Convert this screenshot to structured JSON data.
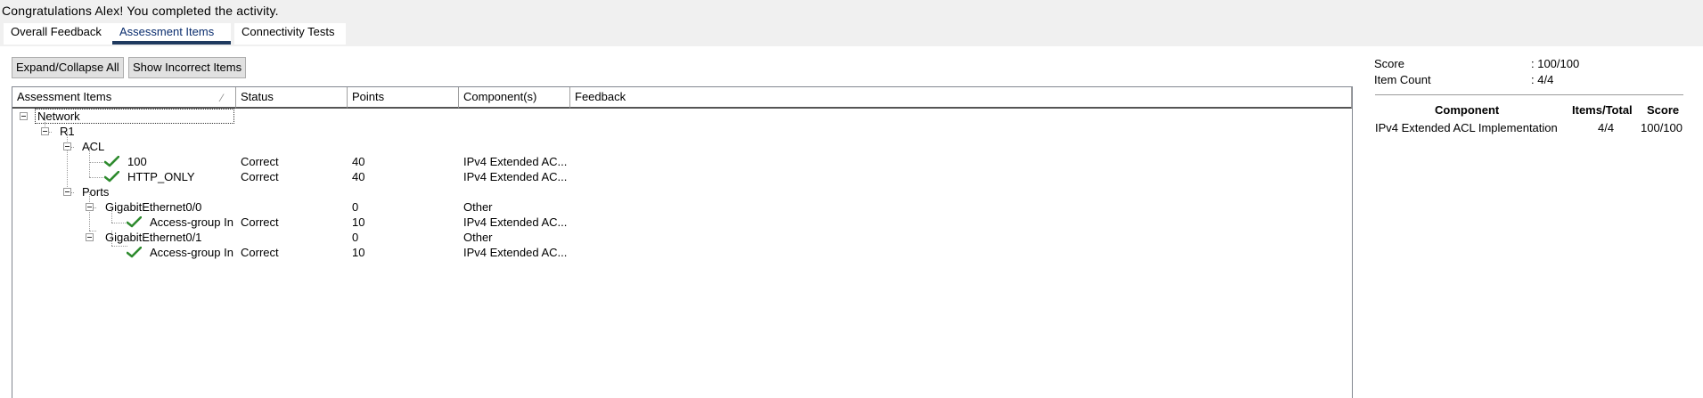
{
  "header": {
    "congrats": "Congratulations Alex! You completed the activity."
  },
  "tabs": [
    {
      "label": "Overall Feedback",
      "selected": false
    },
    {
      "label": "Assessment Items",
      "selected": true
    },
    {
      "label": "Connectivity Tests",
      "selected": false
    }
  ],
  "toolbar": {
    "expand_label": "Expand/Collapse All",
    "show_incorrect_label": "Show Incorrect Items"
  },
  "grid": {
    "columns": [
      "Assessment Items",
      "Status",
      "Points",
      "Component(s)",
      "Feedback"
    ],
    "sort_icon": "sort-indicator-icon",
    "rows": [
      {
        "item": "Network",
        "status": "",
        "points": "",
        "component": "",
        "feedback": "",
        "icon": "collapse-box-icon"
      },
      {
        "item": "R1",
        "status": "",
        "points": "",
        "component": "",
        "feedback": "",
        "icon": "collapse-box-icon"
      },
      {
        "item": "ACL",
        "status": "",
        "points": "",
        "component": "",
        "feedback": "",
        "icon": "collapse-box-icon"
      },
      {
        "item": "100",
        "status": "Correct",
        "points": "40",
        "component": "IPv4 Extended AC...",
        "feedback": "",
        "icon": "check-icon"
      },
      {
        "item": "HTTP_ONLY",
        "status": "Correct",
        "points": "40",
        "component": "IPv4 Extended AC...",
        "feedback": "",
        "icon": "check-icon"
      },
      {
        "item": "Ports",
        "status": "",
        "points": "",
        "component": "",
        "feedback": "",
        "icon": "collapse-box-icon"
      },
      {
        "item": "GigabitEthernet0/0",
        "status": "",
        "points": "0",
        "component": "Other",
        "feedback": "",
        "icon": "collapse-box-icon"
      },
      {
        "item": "Access-group In",
        "status": "Correct",
        "points": "10",
        "component": "IPv4 Extended AC...",
        "feedback": "",
        "icon": "check-icon"
      },
      {
        "item": "GigabitEthernet0/1",
        "status": "",
        "points": "0",
        "component": "Other",
        "feedback": "",
        "icon": "collapse-box-icon"
      },
      {
        "item": "Access-group In",
        "status": "Correct",
        "points": "10",
        "component": "IPv4 Extended AC...",
        "feedback": "",
        "icon": "check-icon"
      }
    ]
  },
  "summary": {
    "score_label": "Score",
    "score_value": ": 100/100",
    "count_label": "Item Count",
    "count_value": ": 4/4",
    "table_headers": [
      "Component",
      "Items/Total",
      "Score"
    ],
    "table_rows": [
      {
        "component": "IPv4 Extended ACL Implementation",
        "items_total": "4/4",
        "score": "100/100"
      }
    ]
  },
  "colors": {
    "check": "#2e8b2e",
    "tab_underline": "#1f3a5f",
    "panel_bg": "#ffffff",
    "window_bg": "#f0f0f0"
  }
}
